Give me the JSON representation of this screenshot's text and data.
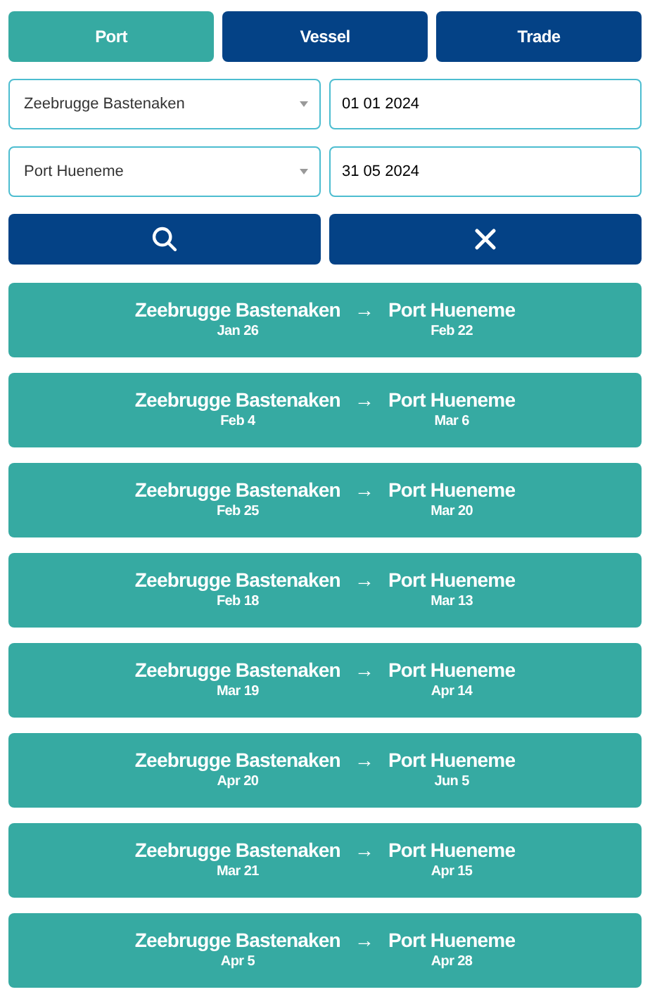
{
  "tabs": [
    {
      "label": "Port",
      "selected": true
    },
    {
      "label": "Vessel",
      "selected": false
    },
    {
      "label": "Trade",
      "selected": false
    }
  ],
  "filters": [
    {
      "port": "Zeebrugge Bastenaken",
      "date": "01 01 2024"
    },
    {
      "port": "Port Hueneme",
      "date": "31 05 2024"
    }
  ],
  "routes": [
    {
      "origin": "Zeebrugge Bastenaken",
      "arrow": "→",
      "destination": "Port Hueneme",
      "departure": "Jan 26",
      "arrival": "Feb 22"
    },
    {
      "origin": "Zeebrugge Bastenaken",
      "arrow": "→",
      "destination": "Port Hueneme",
      "departure": "Feb 4",
      "arrival": "Mar 6"
    },
    {
      "origin": "Zeebrugge Bastenaken",
      "arrow": "→",
      "destination": "Port Hueneme",
      "departure": "Feb 25",
      "arrival": "Mar 20"
    },
    {
      "origin": "Zeebrugge Bastenaken",
      "arrow": "→",
      "destination": "Port Hueneme",
      "departure": "Feb 18",
      "arrival": "Mar 13"
    },
    {
      "origin": "Zeebrugge Bastenaken",
      "arrow": "→",
      "destination": "Port Hueneme",
      "departure": "Mar 19",
      "arrival": "Apr 14"
    },
    {
      "origin": "Zeebrugge Bastenaken",
      "arrow": "→",
      "destination": "Port Hueneme",
      "departure": "Apr 20",
      "arrival": "Jun 5"
    },
    {
      "origin": "Zeebrugge Bastenaken",
      "arrow": "→",
      "destination": "Port Hueneme",
      "departure": "Mar 21",
      "arrival": "Apr 15"
    },
    {
      "origin": "Zeebrugge Bastenaken",
      "arrow": "→",
      "destination": "Port Hueneme",
      "departure": "Apr 5",
      "arrival": "Apr 28"
    }
  ]
}
